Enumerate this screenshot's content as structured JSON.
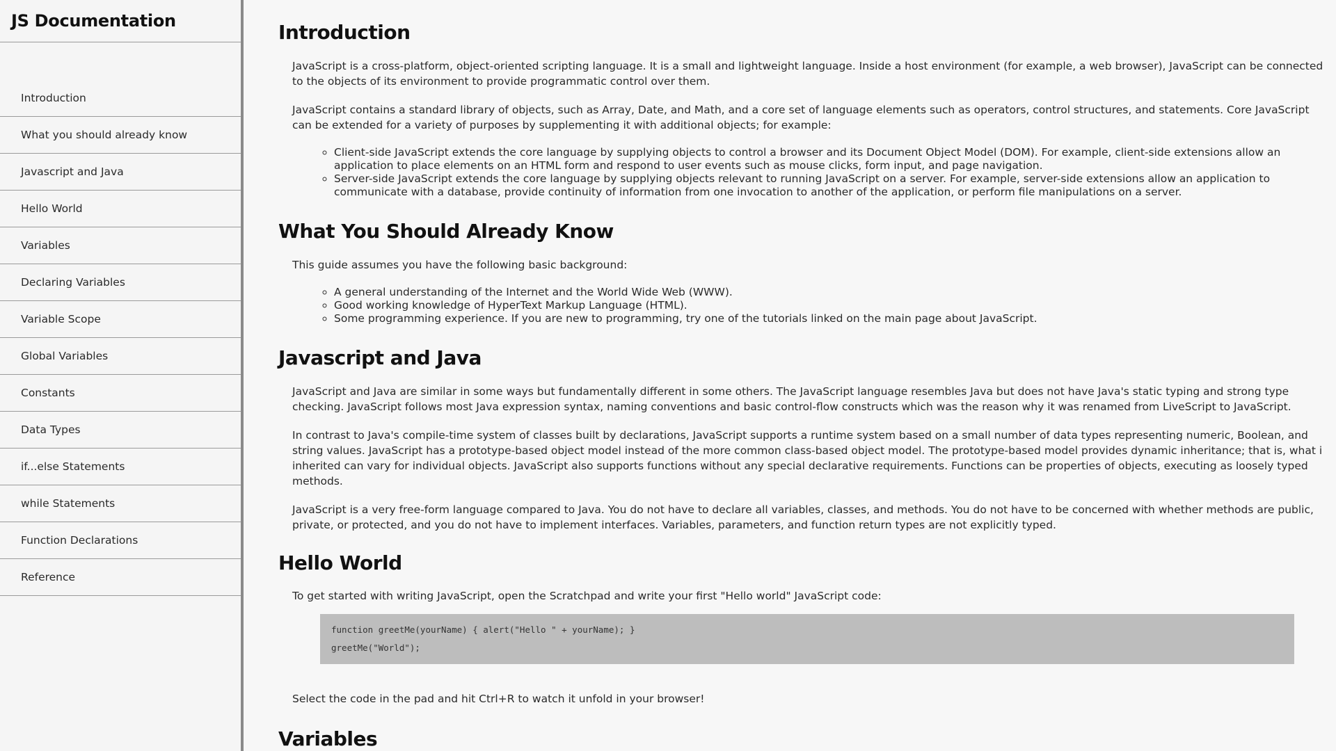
{
  "nav": {
    "title": "JS Documentation",
    "items": [
      {
        "label": "Introduction"
      },
      {
        "label": "What you should already know"
      },
      {
        "label": "Javascript and Java"
      },
      {
        "label": "Hello World"
      },
      {
        "label": "Variables"
      },
      {
        "label": "Declaring Variables"
      },
      {
        "label": "Variable Scope"
      },
      {
        "label": "Global Variables"
      },
      {
        "label": "Constants"
      },
      {
        "label": "Data Types"
      },
      {
        "label": "if...else Statements"
      },
      {
        "label": "while Statements"
      },
      {
        "label": "Function Declarations"
      },
      {
        "label": "Reference"
      }
    ]
  },
  "sections": {
    "introduction": {
      "title": "Introduction",
      "p1": "JavaScript is a cross-platform, object-oriented scripting language. It is a small and lightweight language. Inside a host environment (for example, a web browser), JavaScript can be connected to the objects of its environment to provide programmatic control over them.",
      "p2": "JavaScript contains a standard library of objects, such as Array, Date, and Math, and a core set of language elements such as operators, control structures, and statements. Core JavaScript can be extended for a variety of purposes by supplementing it with additional objects; for example:",
      "list": [
        "Client-side JavaScript extends the core language by supplying objects to control a browser and its Document Object Model (DOM). For example, client-side extensions allow an application to place elements on an HTML form and respond to user events such as mouse clicks, form input, and page navigation.",
        "Server-side JavaScript extends the core language by supplying objects relevant to running JavaScript on a server. For example, server-side extensions allow an application to communicate with a database, provide continuity of information from one invocation to another of the application, or perform file manipulations on a server."
      ]
    },
    "what_you_should_know": {
      "title": "What You Should Already Know",
      "p1": "This guide assumes you have the following basic background:",
      "list": [
        "A general understanding of the Internet and the World Wide Web (WWW).",
        "Good working knowledge of HyperText Markup Language (HTML).",
        "Some programming experience. If you are new to programming, try one of the tutorials linked on the main page about JavaScript."
      ]
    },
    "javascript_and_java": {
      "title": "Javascript and Java",
      "p1": "JavaScript and Java are similar in some ways but fundamentally different in some others. The JavaScript language resembles Java but does not have Java's static typing and strong type checking. JavaScript follows most Java expression syntax, naming conventions and basic control-flow constructs which was the reason why it was renamed from LiveScript to JavaScript.",
      "p2": "In contrast to Java's compile-time system of classes built by declarations, JavaScript supports a runtime system based on a small number of data types representing numeric, Boolean, and string values. JavaScript has a prototype-based object model instead of the more common class-based object model. The prototype-based model provides dynamic inheritance; that is, what is inherited can vary for individual objects. JavaScript also supports functions without any special declarative requirements. Functions can be properties of objects, executing as loosely typed methods.",
      "p3": "JavaScript is a very free-form language compared to Java. You do not have to declare all variables, classes, and methods. You do not have to be concerned with whether methods are public, private, or protected, and you do not have to implement interfaces. Variables, parameters, and function return types are not explicitly typed."
    },
    "hello_world": {
      "title": "Hello World",
      "p1": "To get started with writing JavaScript, open the Scratchpad and write your first \"Hello world\" JavaScript code:",
      "code": [
        "function greetMe(yourName) { alert(\"Hello \" + yourName); }",
        "greetMe(\"World\");"
      ],
      "p2": "Select the code in the pad and hit Ctrl+R to watch it unfold in your browser!"
    },
    "variables": {
      "title": "Variables"
    }
  }
}
